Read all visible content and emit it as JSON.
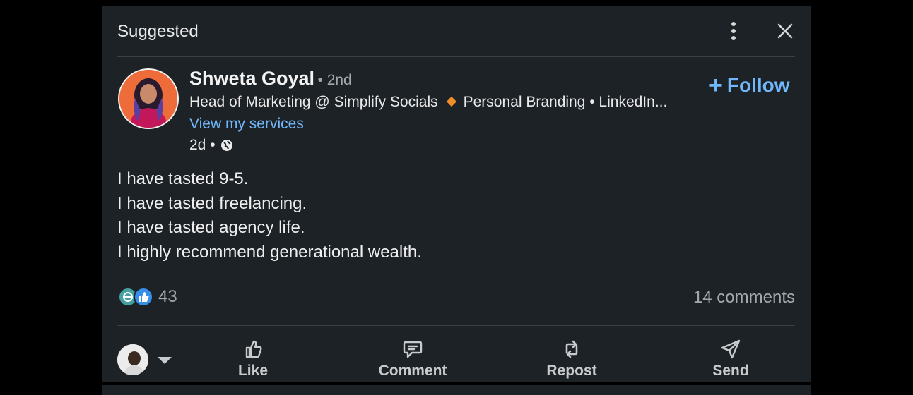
{
  "header": {
    "label": "Suggested",
    "more_icon": "three-dots-vertical-icon",
    "close_icon": "close-x-icon"
  },
  "author": {
    "name": "Shweta Goyal",
    "degree": "• 2nd",
    "headline_part1": "Head of Marketing @ Simplify Socials",
    "headline_part2": "Personal Branding • LinkedIn...",
    "services_link": "View my services",
    "time": "2d •",
    "visibility_icon": "globe-icon"
  },
  "follow": {
    "plus": "+",
    "label": "Follow"
  },
  "post": {
    "lines": [
      "I have tasted 9-5.",
      "I have tasted freelancing.",
      "I have tasted agency life.",
      "I highly recommend generational wealth."
    ]
  },
  "social": {
    "reaction_count": "43",
    "comments": "14 comments",
    "reaction_icons": [
      "celebrate-icon",
      "like-icon"
    ]
  },
  "actions": [
    {
      "label": "Like",
      "icon": "thumbs-up-icon"
    },
    {
      "label": "Comment",
      "icon": "comment-icon"
    },
    {
      "label": "Repost",
      "icon": "repost-icon"
    },
    {
      "label": "Send",
      "icon": "send-icon"
    }
  ],
  "colors": {
    "card_bg": "#1d2226",
    "link_blue": "#71b7fb",
    "muted_text": "#a5a8ab",
    "accent_orange": "#f08f2a"
  }
}
